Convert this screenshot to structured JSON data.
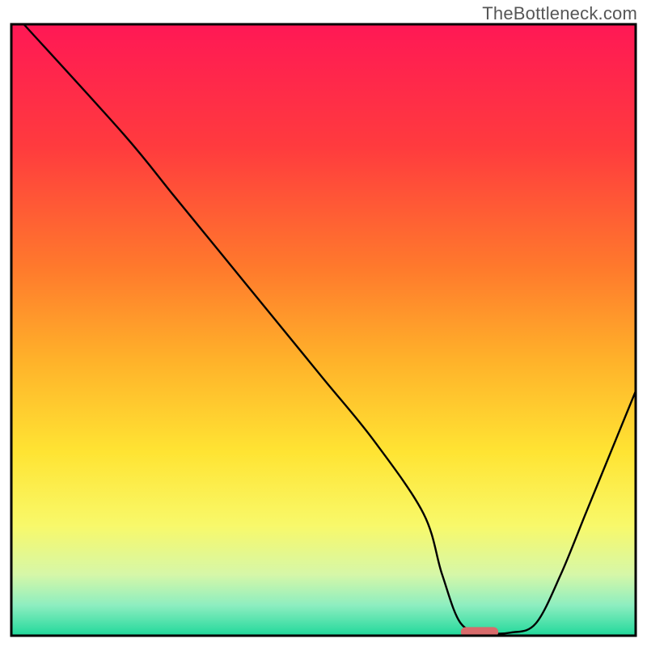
{
  "watermark": "TheBottleneck.com",
  "chart_data": {
    "type": "line",
    "title": "",
    "xlabel": "",
    "ylabel": "",
    "xlim": [
      0,
      100
    ],
    "ylim": [
      0,
      100
    ],
    "series": [
      {
        "name": "curve",
        "x": [
          2,
          18,
          26,
          34,
          42,
          50,
          58,
          66,
          69,
          72,
          76,
          80,
          84,
          88,
          92,
          96,
          100
        ],
        "y": [
          100,
          82,
          72,
          62,
          52,
          42,
          32,
          20,
          10,
          2,
          0.5,
          0.5,
          2,
          10,
          20,
          30,
          40
        ]
      }
    ],
    "gradient_stops": [
      {
        "offset": 0,
        "color": "#ff1855"
      },
      {
        "offset": 20,
        "color": "#ff3b3e"
      },
      {
        "offset": 40,
        "color": "#ff7a2c"
      },
      {
        "offset": 55,
        "color": "#ffb22a"
      },
      {
        "offset": 70,
        "color": "#ffe433"
      },
      {
        "offset": 82,
        "color": "#f8f96a"
      },
      {
        "offset": 90,
        "color": "#d6f7a8"
      },
      {
        "offset": 95,
        "color": "#8eeec0"
      },
      {
        "offset": 100,
        "color": "#20d89b"
      }
    ],
    "marker": {
      "x": 75,
      "y": 0.6,
      "width": 6,
      "height": 1.6,
      "color": "#d86b6b"
    },
    "frame_color": "#000000",
    "curve_color": "#000000",
    "curve_width": 2.4
  }
}
